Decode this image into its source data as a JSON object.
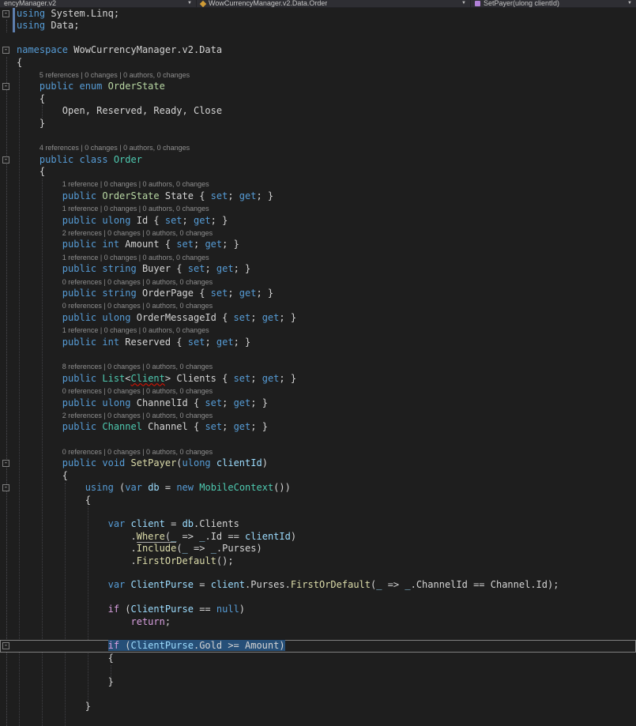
{
  "navbar": {
    "project_dropdown": {
      "label": "encyManager.v2"
    },
    "type_dropdown": {
      "label": "WowCurrencyManager.v2.Data.Order"
    },
    "member_dropdown": {
      "label": "SetPayer(ulong clientId)"
    },
    "chevron_glyph": "▼"
  },
  "colors": {
    "editor_background": "#1e1e1e",
    "navbar_background": "#2e2e33",
    "keyword": "#569cd6",
    "control_keyword": "#d8a0df",
    "type": "#4ec9b0",
    "enum_type": "#b8d7a3",
    "method": "#dcdcaa",
    "identifier_local": "#9cdcfe",
    "text": "#d4d4d4",
    "codelens_text": "#8f8f8f",
    "selection": "#264f78",
    "current_line_border": "#808080",
    "indent_guide": "#404045",
    "error_squiggle": "#e51400",
    "change_bar": "#5e7fae",
    "class_icon_color": "#cf9b36",
    "method_icon_color": "#b180d7"
  },
  "editor": {
    "lines": [
      {
        "t": "code",
        "i": 0,
        "fold": true,
        "bar": true,
        "tk": [
          [
            "kw",
            "using"
          ],
          [
            "pl",
            " System.Linq;"
          ]
        ]
      },
      {
        "t": "code",
        "i": 0,
        "bar": true,
        "tk": [
          [
            "kw",
            "using"
          ],
          [
            "pl",
            " Data;"
          ]
        ]
      },
      {
        "t": "blank"
      },
      {
        "t": "code",
        "i": 0,
        "fold": true,
        "tk": [
          [
            "kw",
            "namespace"
          ],
          [
            "pl",
            " WowCurrencyManager.v2.Data"
          ]
        ]
      },
      {
        "t": "code",
        "i": 0,
        "tk": [
          [
            "pl",
            "{"
          ]
        ]
      },
      {
        "t": "lens",
        "i": 1,
        "text": "5 references | 0 changes | 0 authors, 0 changes"
      },
      {
        "t": "code",
        "i": 1,
        "fold": true,
        "tk": [
          [
            "kw",
            "public enum "
          ],
          [
            "en",
            "OrderState"
          ]
        ]
      },
      {
        "t": "code",
        "i": 1,
        "tk": [
          [
            "pl",
            "{"
          ]
        ]
      },
      {
        "t": "code",
        "i": 2,
        "tk": [
          [
            "pl",
            "Open, Reserved, Ready, Close"
          ]
        ]
      },
      {
        "t": "code",
        "i": 1,
        "tk": [
          [
            "pl",
            "}"
          ]
        ]
      },
      {
        "t": "blank"
      },
      {
        "t": "lens",
        "i": 1,
        "text": "4 references | 0 changes | 0 authors, 0 changes"
      },
      {
        "t": "code",
        "i": 1,
        "fold": true,
        "tk": [
          [
            "kw",
            "public class "
          ],
          [
            "ty",
            "Order"
          ]
        ]
      },
      {
        "t": "code",
        "i": 1,
        "tk": [
          [
            "pl",
            "{"
          ]
        ]
      },
      {
        "t": "lens",
        "i": 2,
        "text": "1 reference | 0 changes | 0 authors, 0 changes"
      },
      {
        "t": "code",
        "i": 2,
        "tk": [
          [
            "kw",
            "public "
          ],
          [
            "en",
            "OrderState"
          ],
          [
            "pl",
            " State { "
          ],
          [
            "kw",
            "set"
          ],
          [
            "pl",
            "; "
          ],
          [
            "kw",
            "get"
          ],
          [
            "pl",
            "; }"
          ]
        ]
      },
      {
        "t": "lens",
        "i": 2,
        "text": "1 reference | 0 changes | 0 authors, 0 changes"
      },
      {
        "t": "code",
        "i": 2,
        "tk": [
          [
            "kw",
            "public ulong "
          ],
          [
            "pl",
            "Id { "
          ],
          [
            "kw",
            "set"
          ],
          [
            "pl",
            "; "
          ],
          [
            "kw",
            "get"
          ],
          [
            "pl",
            "; }"
          ]
        ]
      },
      {
        "t": "lens",
        "i": 2,
        "text": "2 references | 0 changes | 0 authors, 0 changes"
      },
      {
        "t": "code",
        "i": 2,
        "tk": [
          [
            "kw",
            "public int "
          ],
          [
            "pl",
            "Amount { "
          ],
          [
            "kw",
            "set"
          ],
          [
            "pl",
            "; "
          ],
          [
            "kw",
            "get"
          ],
          [
            "pl",
            "; }"
          ]
        ]
      },
      {
        "t": "lens",
        "i": 2,
        "text": "1 reference | 0 changes | 0 authors, 0 changes"
      },
      {
        "t": "code",
        "i": 2,
        "tk": [
          [
            "kw",
            "public string "
          ],
          [
            "pl",
            "Buyer { "
          ],
          [
            "kw",
            "set"
          ],
          [
            "pl",
            "; "
          ],
          [
            "kw",
            "get"
          ],
          [
            "pl",
            "; }"
          ]
        ]
      },
      {
        "t": "lens",
        "i": 2,
        "text": "0 references | 0 changes | 0 authors, 0 changes"
      },
      {
        "t": "code",
        "i": 2,
        "tk": [
          [
            "kw",
            "public string "
          ],
          [
            "pl",
            "OrderPage { "
          ],
          [
            "kw",
            "set"
          ],
          [
            "pl",
            "; "
          ],
          [
            "kw",
            "get"
          ],
          [
            "pl",
            "; }"
          ]
        ]
      },
      {
        "t": "lens",
        "i": 2,
        "text": "0 references | 0 changes | 0 authors, 0 changes"
      },
      {
        "t": "code",
        "i": 2,
        "tk": [
          [
            "kw",
            "public ulong "
          ],
          [
            "pl",
            "OrderMessageId { "
          ],
          [
            "kw",
            "set"
          ],
          [
            "pl",
            "; "
          ],
          [
            "kw",
            "get"
          ],
          [
            "pl",
            "; }"
          ]
        ]
      },
      {
        "t": "lens",
        "i": 2,
        "text": "1 reference | 0 changes | 0 authors, 0 changes"
      },
      {
        "t": "code",
        "i": 2,
        "tk": [
          [
            "kw",
            "public int "
          ],
          [
            "pl",
            "Reserved { "
          ],
          [
            "kw",
            "set"
          ],
          [
            "pl",
            "; "
          ],
          [
            "kw",
            "get"
          ],
          [
            "pl",
            "; }"
          ]
        ]
      },
      {
        "t": "blank"
      },
      {
        "t": "lens",
        "i": 2,
        "text": "8 references | 0 changes | 0 authors, 0 changes"
      },
      {
        "t": "code",
        "i": 2,
        "tk": [
          [
            "kw",
            "public "
          ],
          [
            "ty",
            "List"
          ],
          [
            "pl",
            "<"
          ],
          [
            "ty sq",
            "Client"
          ],
          [
            "pl",
            "> Clients { "
          ],
          [
            "kw",
            "set"
          ],
          [
            "pl",
            "; "
          ],
          [
            "kw",
            "get"
          ],
          [
            "pl",
            "; }"
          ]
        ]
      },
      {
        "t": "lens",
        "i": 2,
        "text": "0 references | 0 changes | 0 authors, 0 changes"
      },
      {
        "t": "code",
        "i": 2,
        "tk": [
          [
            "kw",
            "public ulong "
          ],
          [
            "pl",
            "ChannelId { "
          ],
          [
            "kw",
            "set"
          ],
          [
            "pl",
            "; "
          ],
          [
            "kw",
            "get"
          ],
          [
            "pl",
            "; }"
          ]
        ]
      },
      {
        "t": "lens",
        "i": 2,
        "text": "2 references | 0 changes | 0 authors, 0 changes"
      },
      {
        "t": "code",
        "i": 2,
        "tk": [
          [
            "kw",
            "public "
          ],
          [
            "ty",
            "Channel"
          ],
          [
            "pl",
            " Channel { "
          ],
          [
            "kw",
            "set"
          ],
          [
            "pl",
            "; "
          ],
          [
            "kw",
            "get"
          ],
          [
            "pl",
            "; }"
          ]
        ]
      },
      {
        "t": "blank"
      },
      {
        "t": "lens",
        "i": 2,
        "text": "0 references | 0 changes | 0 authors, 0 changes"
      },
      {
        "t": "code",
        "i": 2,
        "fold": true,
        "tk": [
          [
            "kw",
            "public void "
          ],
          [
            "me",
            "SetPayer"
          ],
          [
            "pl",
            "("
          ],
          [
            "kw",
            "ulong"
          ],
          [
            "pl",
            " "
          ],
          [
            "lo",
            "clientId"
          ],
          [
            "pl",
            ")"
          ]
        ]
      },
      {
        "t": "code",
        "i": 2,
        "tk": [
          [
            "pl",
            "{"
          ]
        ]
      },
      {
        "t": "code",
        "i": 3,
        "fold": true,
        "tk": [
          [
            "kw",
            "using"
          ],
          [
            "pl",
            " ("
          ],
          [
            "kw",
            "var"
          ],
          [
            "pl",
            " "
          ],
          [
            "lo",
            "db"
          ],
          [
            "pl",
            " = "
          ],
          [
            "kw",
            "new"
          ],
          [
            "pl",
            " "
          ],
          [
            "ty",
            "MobileContext"
          ],
          [
            "pl",
            "())"
          ]
        ]
      },
      {
        "t": "code",
        "i": 3,
        "tk": [
          [
            "pl",
            "{"
          ]
        ]
      },
      {
        "t": "blank"
      },
      {
        "t": "code",
        "i": 4,
        "tk": [
          [
            "kw",
            "var"
          ],
          [
            "pl",
            " "
          ],
          [
            "lo",
            "client"
          ],
          [
            "pl",
            " = "
          ],
          [
            "lo",
            "db"
          ],
          [
            "pl",
            ".Clients"
          ]
        ]
      },
      {
        "t": "code",
        "i": 5,
        "tk": [
          [
            "pl",
            "."
          ],
          [
            "me u",
            "Where"
          ],
          [
            "pl u",
            "("
          ],
          [
            "lo u",
            "_"
          ],
          [
            "pl",
            " => "
          ],
          [
            "lo",
            "_"
          ],
          [
            "pl",
            ".Id == "
          ],
          [
            "lo",
            "clientId"
          ],
          [
            "pl",
            ")"
          ]
        ]
      },
      {
        "t": "code",
        "i": 5,
        "tk": [
          [
            "pl",
            "."
          ],
          [
            "me",
            "Include"
          ],
          [
            "pl",
            "("
          ],
          [
            "lo",
            "_"
          ],
          [
            "pl",
            " => "
          ],
          [
            "lo",
            "_"
          ],
          [
            "pl",
            ".Purses)"
          ]
        ]
      },
      {
        "t": "code",
        "i": 5,
        "tk": [
          [
            "pl",
            "."
          ],
          [
            "me",
            "FirstOrDefault"
          ],
          [
            "pl",
            "();"
          ]
        ]
      },
      {
        "t": "blank"
      },
      {
        "t": "code",
        "i": 4,
        "tk": [
          [
            "kw",
            "var"
          ],
          [
            "pl",
            " "
          ],
          [
            "lo",
            "ClientPurse"
          ],
          [
            "pl",
            " = "
          ],
          [
            "lo",
            "client"
          ],
          [
            "pl",
            ".Purses."
          ],
          [
            "me",
            "FirstOrDefault"
          ],
          [
            "pl",
            "("
          ],
          [
            "lo",
            "_"
          ],
          [
            "pl",
            " => "
          ],
          [
            "lo",
            "_"
          ],
          [
            "pl",
            ".ChannelId == Channel.Id);"
          ]
        ]
      },
      {
        "t": "blank"
      },
      {
        "t": "code",
        "i": 4,
        "tk": [
          [
            "ctl",
            "if"
          ],
          [
            "pl",
            " ("
          ],
          [
            "lo",
            "ClientPurse"
          ],
          [
            "pl",
            " == "
          ],
          [
            "kw",
            "null"
          ],
          [
            "pl",
            ")"
          ]
        ]
      },
      {
        "t": "code",
        "i": 5,
        "tk": [
          [
            "ctl",
            "return"
          ],
          [
            "pl",
            ";"
          ]
        ]
      },
      {
        "t": "blank"
      },
      {
        "t": "code",
        "i": 4,
        "fold": true,
        "hl": true,
        "sel": true,
        "tk": [
          [
            "ctl",
            "if"
          ],
          [
            "pl",
            " ("
          ],
          [
            "lo",
            "ClientPurse"
          ],
          [
            "pl",
            ".Gold >= Amount)"
          ]
        ]
      },
      {
        "t": "code",
        "i": 4,
        "tk": [
          [
            "pl",
            "{"
          ]
        ]
      },
      {
        "t": "blank"
      },
      {
        "t": "code",
        "i": 4,
        "tk": [
          [
            "pl",
            "}"
          ]
        ]
      },
      {
        "t": "blank"
      },
      {
        "t": "code",
        "i": 3,
        "tk": [
          [
            "pl",
            "}"
          ]
        ]
      }
    ]
  }
}
